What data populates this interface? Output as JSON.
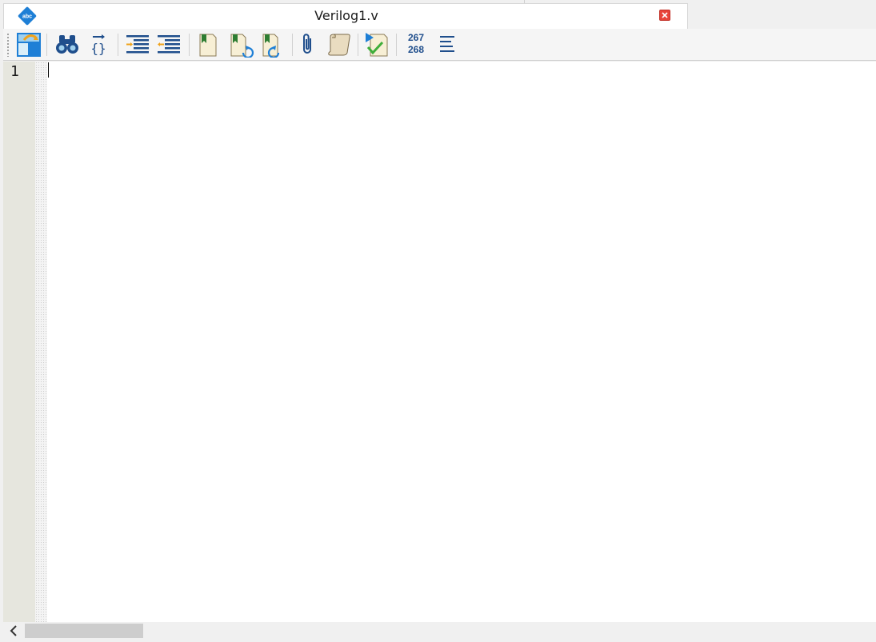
{
  "tab": {
    "title": "Verilog1.v",
    "logo_text": "abc",
    "logo_color": "#1e7fd6",
    "close_icon": "close-icon"
  },
  "toolbar": {
    "items": [
      {
        "name": "window-layout-icon"
      },
      {
        "name": "find-binoculars-icon"
      },
      {
        "name": "find-matching-brace-icon"
      },
      {
        "name": "increase-indent-icon"
      },
      {
        "name": "decrease-indent-icon"
      },
      {
        "name": "toggle-bookmark-icon"
      },
      {
        "name": "next-bookmark-icon"
      },
      {
        "name": "previous-bookmark-icon"
      },
      {
        "name": "attach-icon"
      },
      {
        "name": "insert-template-scroll-icon"
      },
      {
        "name": "analyze-check-icon"
      },
      {
        "name": "line-numbers-icon"
      },
      {
        "name": "align-lines-icon"
      }
    ],
    "line_numbers_icon": {
      "top": "267",
      "bottom": "268"
    }
  },
  "editor": {
    "line_numbers": [
      "1"
    ],
    "content": ""
  },
  "colors": {
    "accent": "#1f4e8c",
    "bookmark_green": "#2e7d32",
    "close_red": "#e8443a",
    "gutter": "#e6e6de"
  }
}
